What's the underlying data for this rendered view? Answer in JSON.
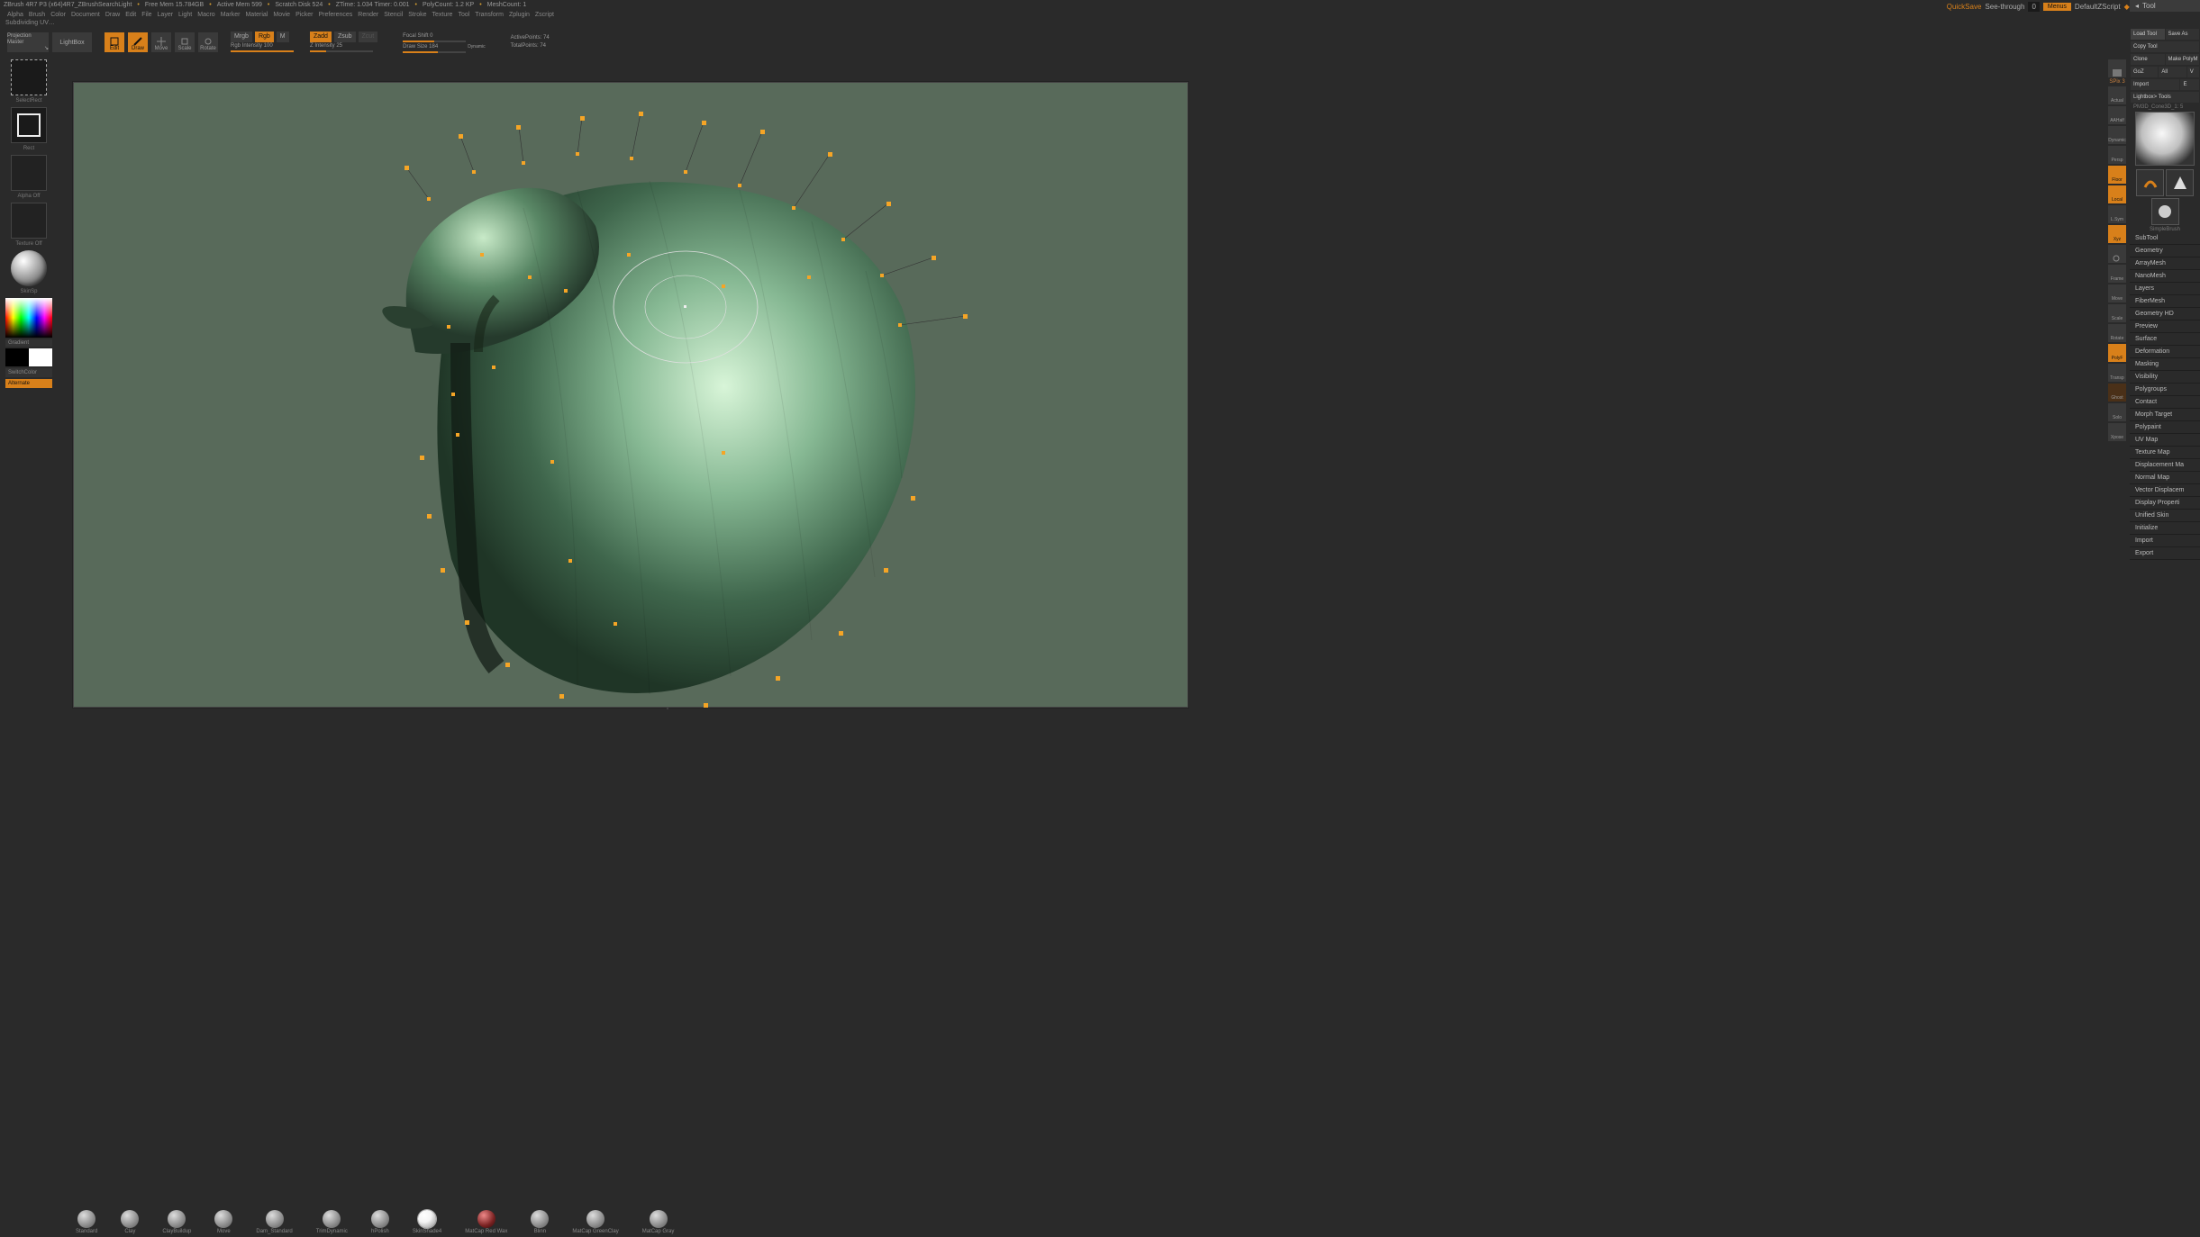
{
  "titlebar": {
    "app": "ZBrush 4R7 P3 (x64)4R7_ZBrushSearchLight",
    "stats": [
      "Free Mem 15.784GB",
      "Active Mem 599",
      "Scratch Disk 524",
      "ZTime: 1.034 Timer: 0.001",
      "PolyCount: 1.2 KP",
      "MeshCount: 1"
    ]
  },
  "right_top": {
    "quicksave": "QuickSave",
    "see_through": "See-through",
    "see_through_val": "0",
    "menus": "Menus",
    "default": "DefaultZScript"
  },
  "menu": [
    "Alpha",
    "Brush",
    "Color",
    "Document",
    "Draw",
    "Edit",
    "File",
    "Layer",
    "Light",
    "Macro",
    "Marker",
    "Material",
    "Movie",
    "Picker",
    "Preferences",
    "Render",
    "Stencil",
    "Stroke",
    "Texture",
    "Tool",
    "Transform",
    "Zplugin",
    "Zscript"
  ],
  "status": "Subdividing UV…",
  "toolbar": {
    "projection": "Projection Master",
    "lightbox": "LightBox",
    "modes": [
      {
        "l": "Edit",
        "on": true
      },
      {
        "l": "Draw",
        "on": true
      },
      {
        "l": "Move",
        "on": false
      },
      {
        "l": "Scale",
        "on": false
      },
      {
        "l": "Rotate",
        "on": false
      }
    ],
    "mrgb": "Mrgb",
    "rgb": "Rgb",
    "m": "M",
    "rgb_int": "Rgb Intensity 100",
    "zadd": "Zadd",
    "zsub": "Zsub",
    "zcut": "Zcut",
    "zint": "Z Intensity 25",
    "focal": "Focal Shift 0",
    "draw": "Draw Size 184",
    "dynamic": "Dynamic",
    "active": "ActivePoints: 74",
    "total": "TotalPoints: 74"
  },
  "left": {
    "select": "SelectRect",
    "rect": "Rect",
    "alpha": "Alpha Off",
    "texture": "Texture Off",
    "material": "SkinSp",
    "gradient": "Gradient",
    "switch": "SwitchColor",
    "alternate": "Alternate"
  },
  "rightcol": {
    "spix": "SPix 3",
    "items": [
      "",
      "Actual",
      "AAHalf",
      "Dynamic",
      "Persp",
      "Floor",
      "Local",
      "L.Sym",
      "Xyz",
      "",
      "Frame",
      "",
      "Move",
      "",
      "Scale",
      "",
      "Rotate",
      "PolyF",
      "",
      "Transp",
      "Ghost",
      "",
      "Solo",
      "",
      "Xpose"
    ]
  },
  "tool": {
    "header": "Tool",
    "top": [
      [
        "Load Tool",
        "Save As"
      ],
      [
        "Copy Tool",
        ""
      ],
      [
        "Clone",
        "Make PolyM"
      ],
      [
        "GoZ",
        "All",
        "V"
      ],
      [
        "Import",
        "E"
      ],
      [
        "Lightbox> Tools",
        ""
      ]
    ],
    "name": "PM3D_Cone3D_1: 5",
    "minis": [
      "SimpleBrush",
      "Cone3D",
      "PM3D_Cone3D_"
    ],
    "sections": [
      "SubTool",
      "Geometry",
      "ArrayMesh",
      "NanoMesh",
      "Layers",
      "FiberMesh",
      "Geometry HD",
      "Preview",
      "Surface",
      "Deformation",
      "Masking",
      "Visibility",
      "Polygroups",
      "Contact",
      "Morph Target",
      "Polypaint",
      "UV Map",
      "Texture Map",
      "Displacement Ma",
      "Normal Map",
      "Vector Displacem",
      "Display Properti",
      "Unified Skin",
      "Initialize",
      "Import",
      "Export"
    ]
  },
  "brushes": [
    "Standard",
    "Clay",
    "ClayBuildup",
    "Move",
    "Dam_Standard",
    "TrimDynamic",
    "hPolish",
    "SkinShade4",
    "MatCap Red Wax",
    "Blinn",
    "MatCap GreenClay",
    "MatCap Gray"
  ]
}
